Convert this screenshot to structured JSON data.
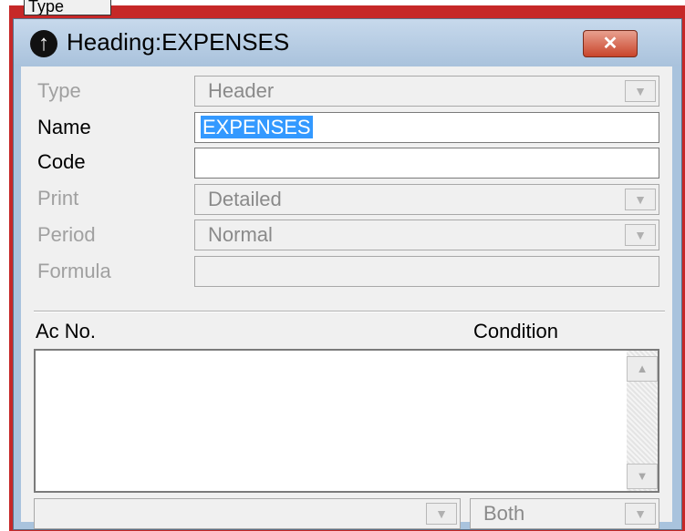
{
  "background_window": {
    "label_fragment": "Type"
  },
  "dialog": {
    "title": "Heading:EXPENSES",
    "icon": "info-icon",
    "close_glyph": "✕"
  },
  "fields": {
    "type": {
      "label": "Type",
      "value": "Header"
    },
    "name": {
      "label": "Name",
      "value": "EXPENSES"
    },
    "code": {
      "label": "Code",
      "value": ""
    },
    "print": {
      "label": "Print",
      "value": "Detailed"
    },
    "period": {
      "label": "Period",
      "value": "Normal"
    },
    "formula": {
      "label": "Formula",
      "value": ""
    }
  },
  "list": {
    "columns": [
      "Ac No.",
      "Condition"
    ],
    "rows": []
  },
  "bottom": {
    "account_value": "",
    "condition_value": "Both"
  },
  "colors": {
    "title_bar": "#a9c3dd",
    "close_button": "#c9452b",
    "selection": "#3399ff",
    "outer_frame": "#c62828"
  }
}
